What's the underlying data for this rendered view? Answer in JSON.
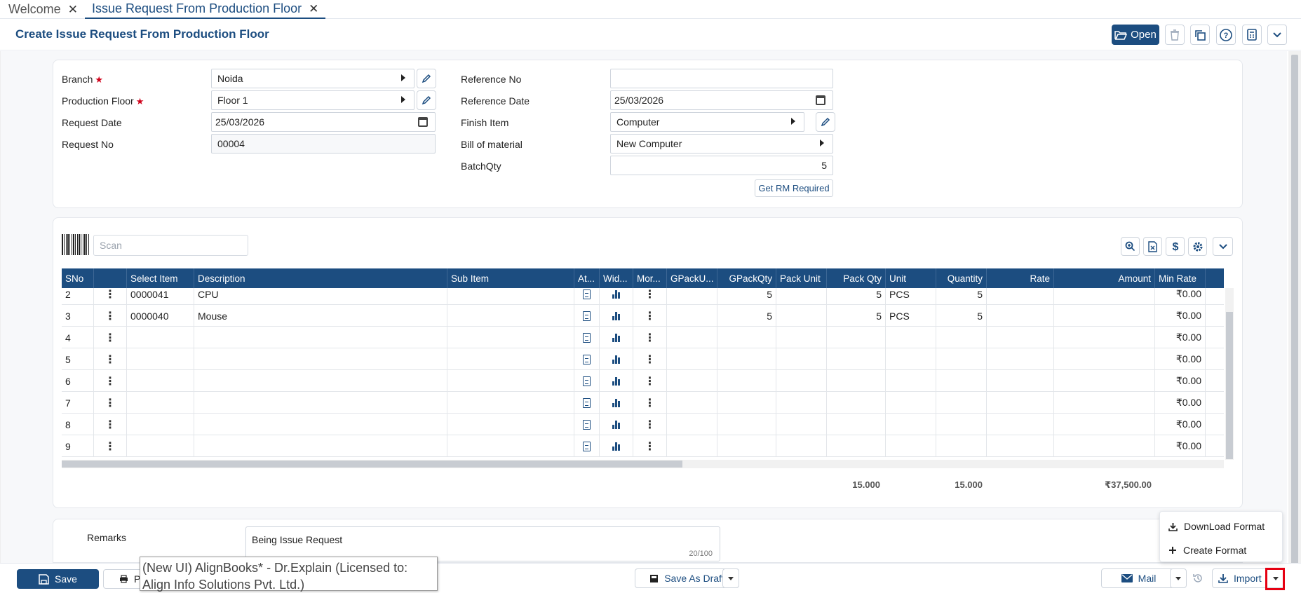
{
  "tabs": [
    {
      "label": "Welcome",
      "active": false
    },
    {
      "label": "Issue Request From Production Floor",
      "active": true
    }
  ],
  "page": {
    "title": "Create Issue Request From Production Floor",
    "open_label": "Open"
  },
  "form": {
    "branch_label": "Branch",
    "branch_value": "Noida",
    "floor_label": "Production Floor",
    "floor_value": "Floor 1",
    "request_date_label": "Request Date",
    "request_date_value": "25/03/2026",
    "request_no_label": "Request No",
    "request_no_value": "00004",
    "ref_no_label": "Reference No",
    "ref_no_value": "",
    "ref_date_label": "Reference Date",
    "ref_date_value": "25/03/2026",
    "finish_item_label": "Finish Item",
    "finish_item_value": "Computer",
    "bom_label": "Bill of material",
    "bom_value": "New Computer",
    "batchqty_label": "BatchQty",
    "batchqty_value": "5",
    "get_rm_label": "Get RM Required"
  },
  "grid": {
    "scan_placeholder": "Scan",
    "columns": [
      "SNo",
      "",
      "Select Item",
      "Description",
      "Sub Item",
      "At...",
      "Wid...",
      "Mor...",
      "GPackU...",
      "GPackQty",
      "Pack Unit",
      "Pack Qty",
      "Unit",
      "Quantity",
      "Rate",
      "Amount",
      "Min Rate"
    ],
    "rows": [
      {
        "sno": "2",
        "item": "0000041",
        "desc": "CPU",
        "gpackqty": "5",
        "packqty": "5",
        "unit": "PCS",
        "qty": "5",
        "minrate": "₹0.00"
      },
      {
        "sno": "3",
        "item": "0000040",
        "desc": "Mouse",
        "gpackqty": "5",
        "packqty": "5",
        "unit": "PCS",
        "qty": "5",
        "minrate": "₹0.00"
      },
      {
        "sno": "4",
        "item": "",
        "desc": "",
        "gpackqty": "",
        "packqty": "",
        "unit": "",
        "qty": "",
        "minrate": "₹0.00"
      },
      {
        "sno": "5",
        "item": "",
        "desc": "",
        "gpackqty": "",
        "packqty": "",
        "unit": "",
        "qty": "",
        "minrate": "₹0.00"
      },
      {
        "sno": "6",
        "item": "",
        "desc": "",
        "gpackqty": "",
        "packqty": "",
        "unit": "",
        "qty": "",
        "minrate": "₹0.00"
      },
      {
        "sno": "7",
        "item": "",
        "desc": "",
        "gpackqty": "",
        "packqty": "",
        "unit": "",
        "qty": "",
        "minrate": "₹0.00"
      },
      {
        "sno": "8",
        "item": "",
        "desc": "",
        "gpackqty": "",
        "packqty": "",
        "unit": "",
        "qty": "",
        "minrate": "₹0.00"
      },
      {
        "sno": "9",
        "item": "",
        "desc": "",
        "gpackqty": "",
        "packqty": "",
        "unit": "",
        "qty": "",
        "minrate": "₹0.00"
      }
    ],
    "totals": {
      "packqty": "15.000",
      "quantity": "15.000",
      "amount": "₹37,500.00"
    }
  },
  "remarks": {
    "label": "Remarks",
    "value": "Being Issue Request",
    "count": "20/100"
  },
  "bottom": {
    "save_label": "Save",
    "print_label": "P",
    "draft_label": "Save As Draft",
    "mail_label": "Mail",
    "import_label": "Import"
  },
  "import_menu": {
    "download_label": "DownLoad Format",
    "create_label": "Create Format"
  },
  "tooltip_text": "(New UI) AlignBooks* - Dr.Explain (Licensed to: Align Info Solutions Pvt. Ltd.)",
  "colors": {
    "primary": "#1c4d80",
    "highlight": "#e60012"
  }
}
